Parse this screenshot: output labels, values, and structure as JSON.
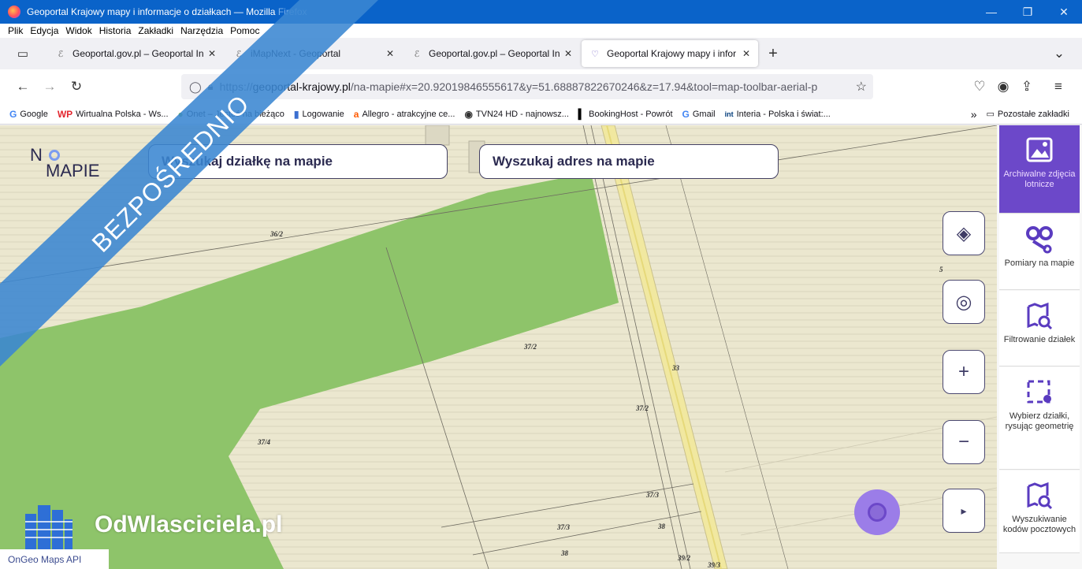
{
  "window": {
    "title_main": "Geoportal Krajowy mapy i informacje o działkach — Mozilla",
    "title_app": "Firefox",
    "minimize": "—",
    "maximize": "❐",
    "close": "✕"
  },
  "menu": [
    "Plik",
    "Edycja",
    "Widok",
    "Historia",
    "Zakładki",
    "Narzędzia",
    "Pomoc"
  ],
  "tabs": [
    {
      "label": "Geoportal.gov.pl – Geoportal In",
      "close": "✕",
      "active": false
    },
    {
      "label": "iMapNext - Geoportal",
      "close": "✕",
      "active": false
    },
    {
      "label": "Geoportal.gov.pl – Geoportal In",
      "close": "✕",
      "active": false
    },
    {
      "label": "Geoportal Krajowy mapy i infor",
      "close": "✕",
      "active": true
    }
  ],
  "new_tab": "+",
  "tab_list": "⌄",
  "address": {
    "prefix": "https://",
    "host": "geoportal-krajowy.pl",
    "path": "/na-mapie#x=20.92019846555617&y=51.68887822670246&z=17.94&tool=map-toolbar-aerial-p"
  },
  "bookmarks": [
    {
      "icon": "G",
      "label": "Google",
      "color": "#4285f4"
    },
    {
      "icon": "WP",
      "label": "Wirtualna Polska - Ws...",
      "color": "#e3262f"
    },
    {
      "icon": "●",
      "label": "Onet – Jesteś na bieżąco",
      "color": "#6fb24a"
    },
    {
      "icon": "▮",
      "label": "Logowanie",
      "color": "#3b6fd0"
    },
    {
      "icon": "a",
      "label": "Allegro - atrakcyjne ce...",
      "color": "#ff5a00"
    },
    {
      "icon": "◉",
      "label": "TVN24 HD - najnowsz...",
      "color": "#333333"
    },
    {
      "icon": "▍",
      "label": "BookingHost - Powrót",
      "color": "#000000"
    },
    {
      "icon": "G",
      "label": "Gmail",
      "color": "#4285f4"
    },
    {
      "icon": "int",
      "label": "Interia - Polska i świat:...",
      "color": "#003b7a"
    }
  ],
  "bookmarks_more": "»",
  "bookmarks_other": "Pozostałe zakładki",
  "site": {
    "logo_top": "N",
    "logo_bottom": "MAPIE",
    "search_parcel": "Wyszukaj działkę na mapie",
    "search_address": "Wyszukaj adres na mapie",
    "ribbon": "BEZPOŚREDNIO",
    "watermark": "OdWlasciciela.pl",
    "ongeo": "OnGeo Maps API",
    "controls": [
      "layers-icon",
      "locate-icon",
      "+",
      "−",
      "▸"
    ]
  },
  "parcels": [
    "36/2",
    "37/2",
    "37/2",
    "37/4",
    "33",
    "37/3",
    "37/3",
    "38",
    "38",
    "39/2",
    "39/3",
    "5"
  ],
  "right_panel": [
    {
      "label": "Archiwalne zdjęcia lotnicze",
      "active": true
    },
    {
      "label": "Pomiary na mapie",
      "active": false
    },
    {
      "label": "Filtrowanie działek",
      "active": false
    },
    {
      "label": "Wybierz działki, rysując geometrię",
      "active": false
    },
    {
      "label": "Wyszukiwanie kodów pocztowych",
      "active": false
    }
  ],
  "colors": {
    "titlebar": "#0a63c9",
    "ribbon": "#3a86d1",
    "accent": "#6c48c9",
    "map_bg": "#ebe7cf",
    "field_green": "#8ec46a"
  }
}
